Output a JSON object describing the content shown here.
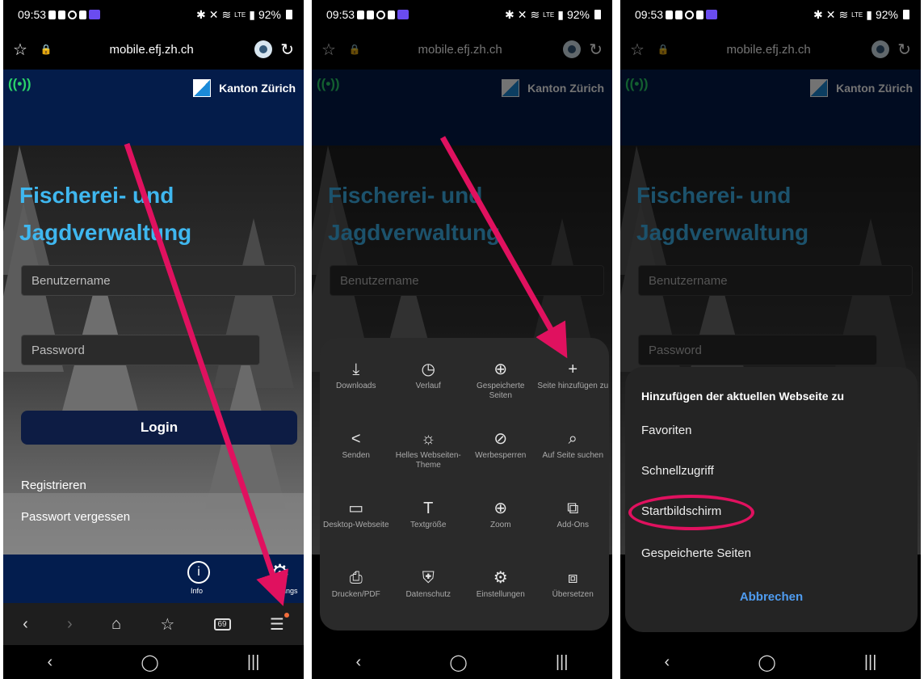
{
  "status": {
    "time": "09:53",
    "battery": "92%",
    "signal": "LTE"
  },
  "browser": {
    "url": "mobile.efj.zh.ch",
    "tab_count": "69"
  },
  "site": {
    "brand": "Kanton Zürich",
    "title_line1": "Fischerei- und",
    "title_line2": "Jagdverwaltung",
    "username_placeholder": "Benutzername",
    "password_placeholder": "Password",
    "login_label": "Login",
    "register_link": "Registrieren",
    "forgot_link": "Passwort vergessen",
    "info_label": "Info",
    "settings_label": "Settings"
  },
  "menu": {
    "items": [
      {
        "label": "Downloads",
        "icon": "download-icon"
      },
      {
        "label": "Verlauf",
        "icon": "history-icon"
      },
      {
        "label": "Gespeicherte Seiten",
        "icon": "saved-pages-icon"
      },
      {
        "label": "Seite hinzufügen zu",
        "icon": "plus-icon"
      },
      {
        "label": "Senden",
        "icon": "share-icon"
      },
      {
        "label": "Helles Webseiten-Theme",
        "icon": "sun-icon"
      },
      {
        "label": "Werbesperren",
        "icon": "ad-block-icon"
      },
      {
        "label": "Auf Seite suchen",
        "icon": "find-in-page-icon"
      },
      {
        "label": "Desktop-Webseite",
        "icon": "desktop-icon"
      },
      {
        "label": "Textgröße",
        "icon": "text-size-icon"
      },
      {
        "label": "Zoom",
        "icon": "zoom-icon"
      },
      {
        "label": "Add-Ons",
        "icon": "addons-icon"
      },
      {
        "label": "Drucken/PDF",
        "icon": "print-icon"
      },
      {
        "label": "Datenschutz",
        "icon": "privacy-icon"
      },
      {
        "label": "Einstellungen",
        "icon": "settings-icon"
      },
      {
        "label": "Übersetzen",
        "icon": "translate-icon"
      }
    ]
  },
  "add_dialog": {
    "title": "Hinzufügen der aktuellen Webseite zu",
    "options": [
      "Favoriten",
      "Schnellzugriff",
      "Startbildschirm",
      "Gespeicherte Seiten"
    ],
    "cancel": "Abbrechen"
  },
  "colors": {
    "header": "#041c4a",
    "title": "#3fb7ef",
    "arrow": "#e0115f",
    "cancel": "#4f9cf0"
  }
}
